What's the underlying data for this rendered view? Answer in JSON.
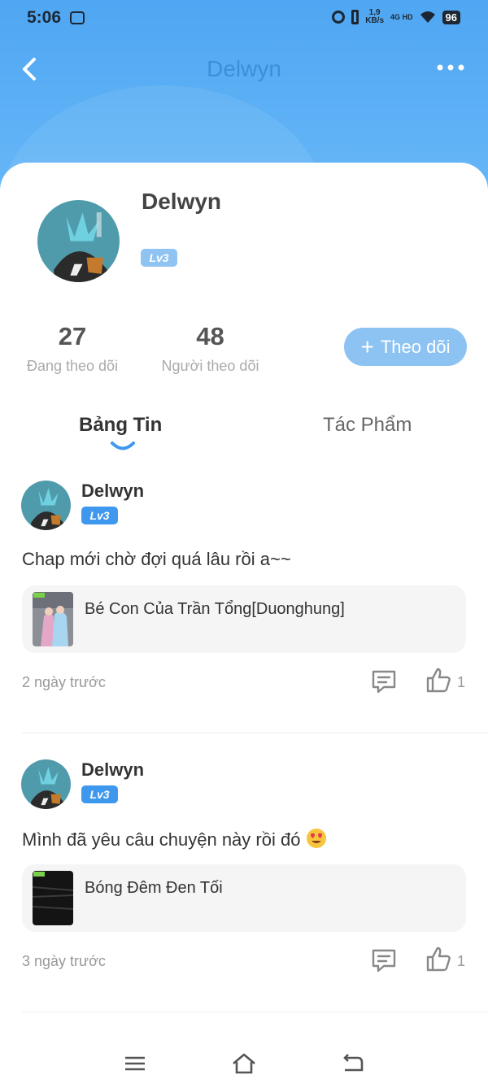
{
  "status_bar": {
    "time": "5:06",
    "speed_value": "1,9",
    "speed_unit": "KB/s",
    "network_top": "4G HD",
    "battery": "96"
  },
  "nav": {
    "title": "Delwyn"
  },
  "profile": {
    "name": "Delwyn",
    "level": "Lv3",
    "following_count": "27",
    "following_label": "Đang theo dõi",
    "followers_count": "48",
    "followers_label": "Người theo dõi",
    "follow_plus": "+",
    "follow_label": "Theo dõi"
  },
  "tabs": {
    "feed": "Bảng Tin",
    "works": "Tác Phẩm"
  },
  "posts": [
    {
      "author": "Delwyn",
      "level": "Lv3",
      "text": "Chap mới chờ đợi quá lâu rồi a~~",
      "work_title": "Bé Con Của Trần Tổng[Duonghung]",
      "time": "2 ngày trước",
      "likes": "1"
    },
    {
      "author": "Delwyn",
      "level": "Lv3",
      "text": "Mình đã yêu câu chuyện này rồi đó",
      "work_title": "Bóng Đêm Đen Tối",
      "time": "3 ngày trước",
      "likes": "1"
    }
  ],
  "colors": {
    "header_blue": "#4fa6f2",
    "badge_blue": "#3e98ee",
    "follow_button": "#8cc3f3"
  },
  "icons": {
    "back": "chevron-left-icon",
    "more": "more-dots-icon",
    "comment": "comment-icon",
    "like": "thumbs-up-icon"
  }
}
